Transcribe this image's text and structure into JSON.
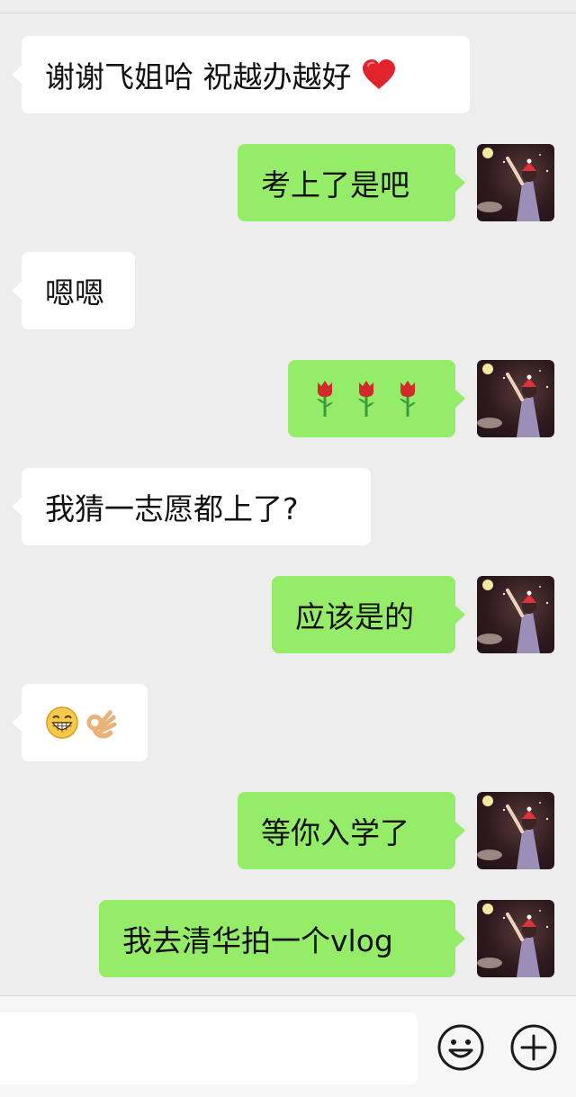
{
  "colors": {
    "background": "#ededed",
    "incoming_bubble": "#ffffff",
    "outgoing_bubble": "#95ec69",
    "input_bar": "#f6f6f6"
  },
  "messages": [
    {
      "id": 1,
      "direction": "incoming",
      "text": "谢谢飞姐哈 祝越办越好",
      "trailing_emoji": "red-heart"
    },
    {
      "id": 2,
      "direction": "outgoing",
      "text": "考上了是吧"
    },
    {
      "id": 3,
      "direction": "incoming",
      "text": "嗯嗯"
    },
    {
      "id": 4,
      "direction": "outgoing",
      "text": "",
      "emoji": [
        "rose",
        "rose",
        "rose"
      ]
    },
    {
      "id": 5,
      "direction": "incoming",
      "text": "我猜一志愿都上了?"
    },
    {
      "id": 6,
      "direction": "outgoing",
      "text": "应该是的"
    },
    {
      "id": 7,
      "direction": "incoming",
      "text": "",
      "emoji": [
        "grinning-face",
        "ok-hand"
      ]
    },
    {
      "id": 8,
      "direction": "outgoing",
      "text": "等你入学了"
    },
    {
      "id": 9,
      "direction": "outgoing",
      "text": "我去清华拍一个vlog"
    }
  ],
  "input": {
    "value": "",
    "placeholder": ""
  },
  "icons": {
    "emoji_button": "smiley-icon",
    "more_button": "plus-circle-icon",
    "avatar": "user-avatar"
  }
}
